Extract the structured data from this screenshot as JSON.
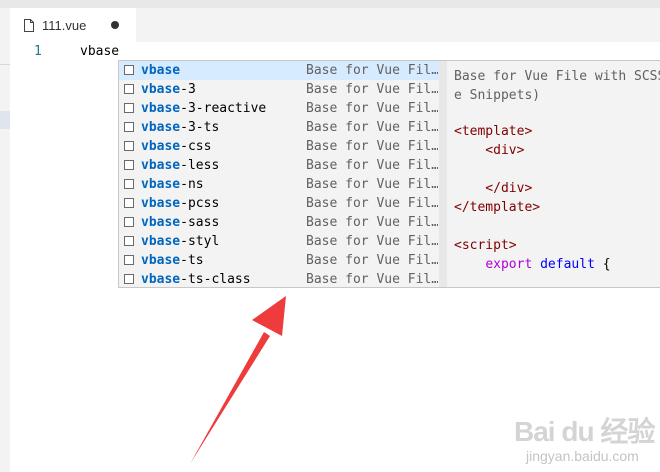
{
  "tab": {
    "label": "111.vue",
    "file_icon": "file-icon",
    "dirty": true
  },
  "editor": {
    "line_number": "1",
    "code": "vbase"
  },
  "suggest": {
    "typed": "vbase",
    "items": [
      {
        "match": "vbase",
        "rest": "",
        "detail": "Base for Vue Fil…",
        "selected": true
      },
      {
        "match": "vbase",
        "rest": "-3",
        "detail": "Base for Vue Fil…"
      },
      {
        "match": "vbase",
        "rest": "-3-reactive",
        "detail": "Base for Vue Fil…"
      },
      {
        "match": "vbase",
        "rest": "-3-ts",
        "detail": "Base for Vue Fil…"
      },
      {
        "match": "vbase",
        "rest": "-css",
        "detail": "Base for Vue Fil…"
      },
      {
        "match": "vbase",
        "rest": "-less",
        "detail": "Base for Vue Fil…"
      },
      {
        "match": "vbase",
        "rest": "-ns",
        "detail": "Base for Vue Fil…"
      },
      {
        "match": "vbase",
        "rest": "-pcss",
        "detail": "Base for Vue Fil…"
      },
      {
        "match": "vbase",
        "rest": "-sass",
        "detail": "Base for Vue Fil…"
      },
      {
        "match": "vbase",
        "rest": "-styl",
        "detail": "Base for Vue Fil…"
      },
      {
        "match": "vbase",
        "rest": "-ts",
        "detail": "Base for Vue Fil…"
      },
      {
        "match": "vbase",
        "rest": "-ts-class",
        "detail": "Base for Vue Fil…"
      }
    ]
  },
  "details": {
    "description": "Base for Vue File with SCSS\ne Snippets)",
    "code_lines": [
      {
        "text": "<template>",
        "cls": "tag"
      },
      {
        "text": "    <div>",
        "cls": "tag"
      },
      {
        "text": "",
        "cls": "plain"
      },
      {
        "text": "    </div>",
        "cls": "tag"
      },
      {
        "text": "</template>",
        "cls": "tag"
      },
      {
        "text": "",
        "cls": "plain"
      },
      {
        "text": "<script>",
        "cls": "tag"
      },
      {
        "text": "    export default {",
        "cls": "mixed"
      }
    ],
    "export_kw": "export",
    "default_kw": "default",
    "brace": " {"
  },
  "watermark": {
    "text": "Bai du 经验",
    "sub": "jingyan.baidu.com"
  },
  "colors": {
    "arrow": "#ee3b3b",
    "match": "#0066bf",
    "selected_row": "#d6ebff"
  }
}
